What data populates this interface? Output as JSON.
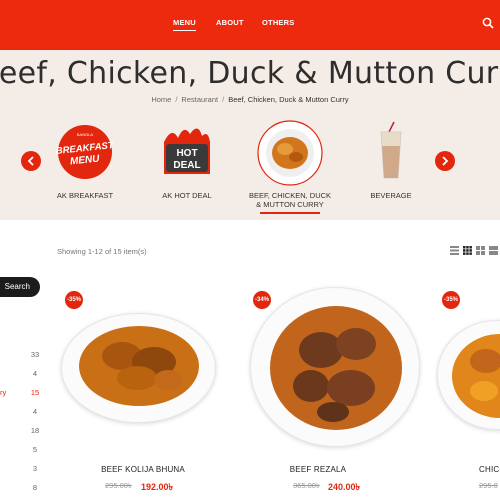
{
  "nav": {
    "items": [
      {
        "label": "MENU",
        "active": true
      },
      {
        "label": "ABOUT",
        "active": false
      },
      {
        "label": "OTHERS",
        "active": false
      }
    ],
    "search_icon": "search-icon"
  },
  "hero": {
    "title": "Beef, Chicken, Duck & Mutton Curry",
    "breadcrumb": [
      "Home",
      "Restaurant",
      "Beef, Chicken, Duck & Mutton Curry"
    ]
  },
  "categories": [
    {
      "label": "AK BREAKFAST",
      "image_text_1": "BREAKFAST",
      "image_text_2": "MENU",
      "image_top": "BANGLA"
    },
    {
      "label": "AK HOT DEAL",
      "image_text_1": "HOT",
      "image_text_2": "DEAL"
    },
    {
      "label_line1": "BEEF, CHICKEN, DUCK",
      "label_line2": "& MUTTON CURRY",
      "active": true
    },
    {
      "label": "BEVERAGE"
    }
  ],
  "listing": {
    "showing": "Showing 1-12 of 15 item(s)"
  },
  "sidebar": {
    "search_label": "Search",
    "cut_label": "ry",
    "counts": [
      "33",
      "4",
      "15",
      "4",
      "18",
      "5",
      "3",
      "8"
    ]
  },
  "products": [
    {
      "name": "BEEF KOLIJA BHUNA",
      "discount": "-35%",
      "old_price": "295.00৳",
      "new_price": "192.00৳"
    },
    {
      "name": "BEEF REZALA",
      "discount": "-34%",
      "old_price": "365.00৳",
      "new_price": "240.00৳"
    },
    {
      "name": "CHIC",
      "discount": "-35%",
      "old_price": "295.0"
    }
  ],
  "colors": {
    "brand_red": "#ee2a0e",
    "accent_red": "#e3260e",
    "hero_bg": "#f4ece6"
  }
}
